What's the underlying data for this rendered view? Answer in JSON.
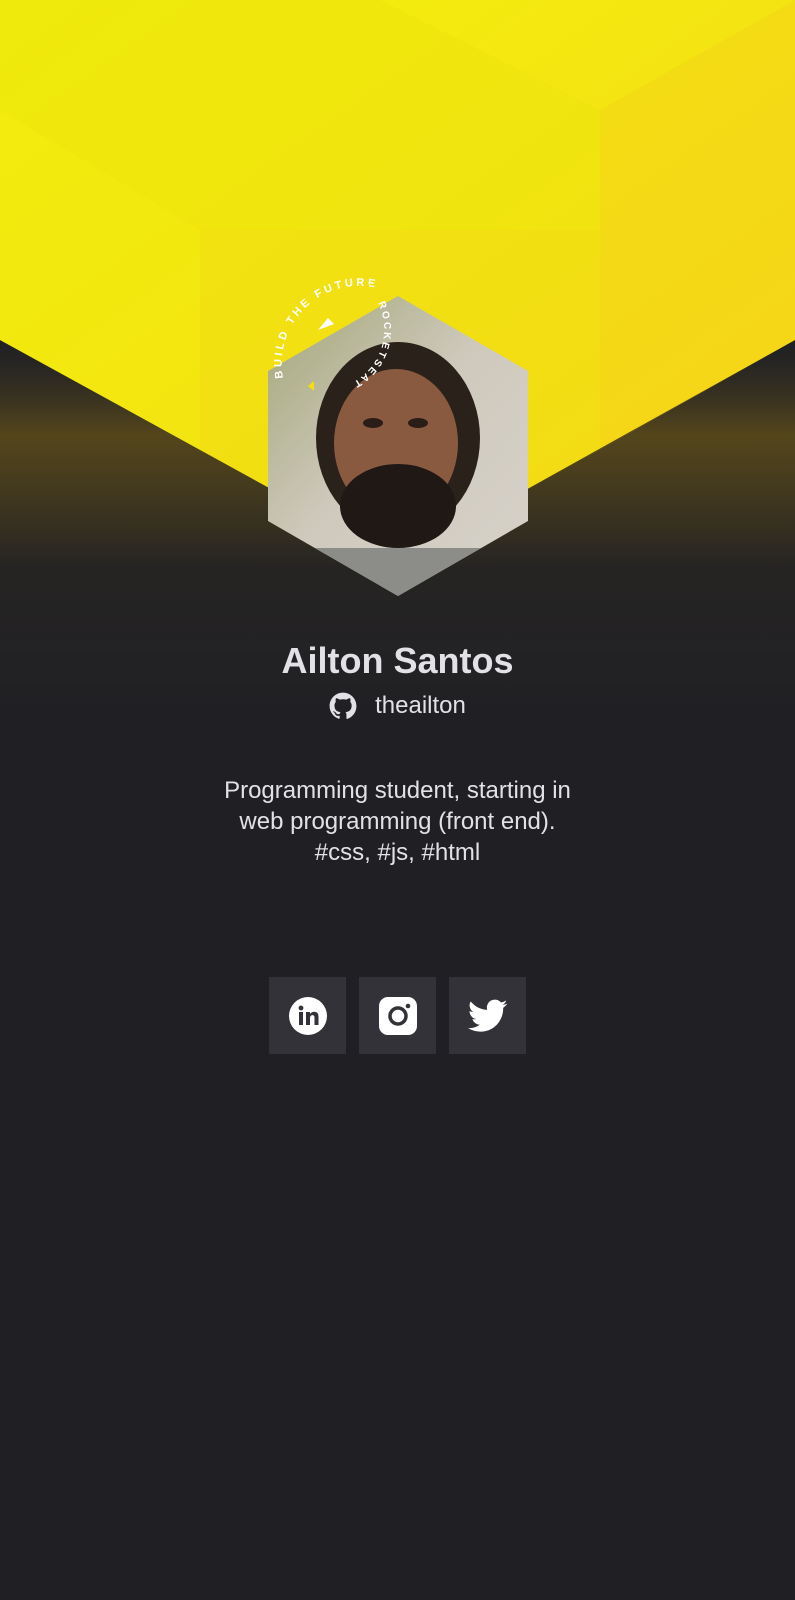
{
  "profile": {
    "name": "Ailton Santos",
    "github_handle": "theailton",
    "bio_lines": [
      "Programming student, starting in",
      "web programming (front end).",
      "#css, #js, #html"
    ],
    "badge_text_top": "BUILD THE FUTURE",
    "badge_text_side": "ROCKETSEAT"
  },
  "socials": [
    {
      "name": "linkedin",
      "icon": "linkedin-icon"
    },
    {
      "name": "instagram",
      "icon": "instagram-icon"
    },
    {
      "name": "twitter",
      "icon": "twitter-icon"
    }
  ],
  "colors": {
    "background": "#202024",
    "accent_yellow": "#F7DD0F",
    "button_bg": "#323238",
    "text": "#E1E1E6"
  }
}
